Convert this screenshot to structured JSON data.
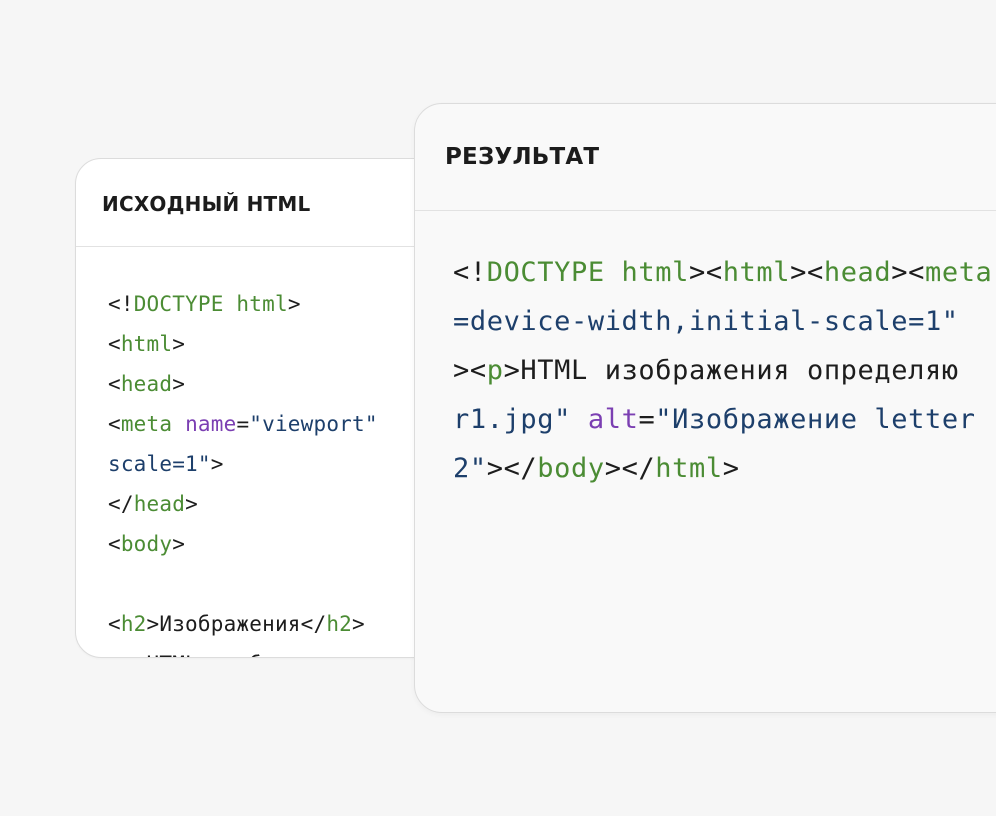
{
  "colors": {
    "background": "#f6f6f6",
    "card": "#ffffff",
    "result_card": "#f9f9f9",
    "tag": "#4b8c34",
    "attribute": "#7b3fb2",
    "string": "#1d3f6b",
    "text": "#1d1d1d"
  },
  "source": {
    "title": "ИСХОДНЫЙ HTML",
    "lines": [
      [
        {
          "t": "<!",
          "k": "plain"
        },
        {
          "t": "DOCTYPE html",
          "k": "tag"
        },
        {
          "t": ">",
          "k": "plain"
        }
      ],
      [
        {
          "t": "<",
          "k": "plain"
        },
        {
          "t": "html",
          "k": "tag"
        },
        {
          "t": ">",
          "k": "plain"
        }
      ],
      [
        {
          "t": "<",
          "k": "plain"
        },
        {
          "t": "head",
          "k": "tag"
        },
        {
          "t": ">",
          "k": "plain"
        }
      ],
      [
        {
          "t": "<",
          "k": "plain"
        },
        {
          "t": "meta",
          "k": "tag"
        },
        {
          "t": " ",
          "k": "plain"
        },
        {
          "t": "name",
          "k": "attr"
        },
        {
          "t": "=",
          "k": "plain"
        },
        {
          "t": "\"viewport\"",
          "k": "str"
        }
      ],
      [
        {
          "t": "scale=1\"",
          "k": "str"
        },
        {
          "t": ">",
          "k": "plain"
        }
      ],
      [
        {
          "t": "</",
          "k": "plain"
        },
        {
          "t": "head",
          "k": "tag"
        },
        {
          "t": ">",
          "k": "plain"
        }
      ],
      [
        {
          "t": "<",
          "k": "plain"
        },
        {
          "t": "body",
          "k": "tag"
        },
        {
          "t": ">",
          "k": "plain"
        }
      ],
      [],
      [
        {
          "t": "<",
          "k": "plain"
        },
        {
          "t": "h2",
          "k": "tag"
        },
        {
          "t": ">Изображения</",
          "k": "plain"
        },
        {
          "t": "h2",
          "k": "tag"
        },
        {
          "t": ">",
          "k": "plain"
        }
      ],
      [
        {
          "t": "<",
          "k": "plain"
        },
        {
          "t": "p",
          "k": "tag"
        },
        {
          "t": ">HTML изображения о",
          "k": "plain"
        }
      ]
    ]
  },
  "result": {
    "title": "РЕЗУЛЬТАТ",
    "lines": [
      [
        {
          "t": "<!",
          "k": "plain"
        },
        {
          "t": "DOCTYPE html",
          "k": "tag"
        },
        {
          "t": "><",
          "k": "plain"
        },
        {
          "t": "html",
          "k": "tag"
        },
        {
          "t": "><",
          "k": "plain"
        },
        {
          "t": "head",
          "k": "tag"
        },
        {
          "t": "><",
          "k": "plain"
        },
        {
          "t": "meta",
          "k": "tag"
        }
      ],
      [
        {
          "t": "=device-width,initial-scale=1\"",
          "k": "str"
        }
      ],
      [
        {
          "t": "><",
          "k": "plain"
        },
        {
          "t": "p",
          "k": "tag"
        },
        {
          "t": ">HTML изображения определяю",
          "k": "plain"
        }
      ],
      [
        {
          "t": "r1.jpg\"",
          "k": "str"
        },
        {
          "t": " ",
          "k": "plain"
        },
        {
          "t": "alt",
          "k": "attr"
        },
        {
          "t": "=",
          "k": "plain"
        },
        {
          "t": "\"Изображение letter",
          "k": "str"
        }
      ],
      [
        {
          "t": "2\"",
          "k": "str"
        },
        {
          "t": "></",
          "k": "plain"
        },
        {
          "t": "body",
          "k": "tag"
        },
        {
          "t": "></",
          "k": "plain"
        },
        {
          "t": "html",
          "k": "tag"
        },
        {
          "t": ">",
          "k": "plain"
        }
      ]
    ]
  }
}
